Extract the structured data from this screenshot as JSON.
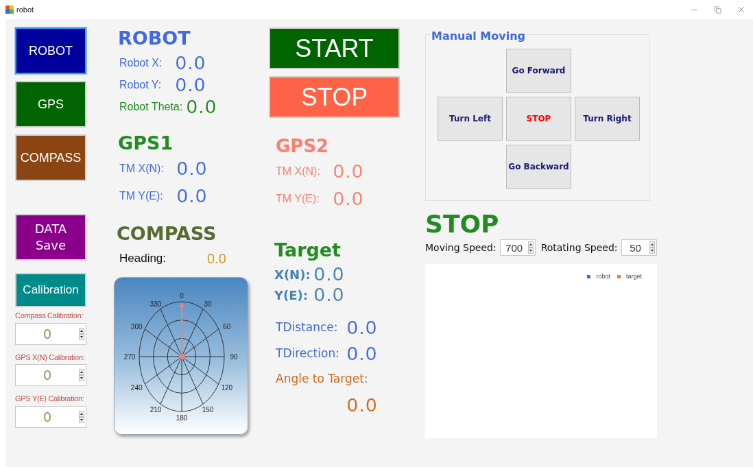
{
  "window": {
    "title": "robot"
  },
  "side_buttons": [
    {
      "label": "ROBOT",
      "color": "#00009c",
      "focused": true
    },
    {
      "label": "GPS",
      "color": "#006400",
      "focused": false
    },
    {
      "label": "COMPASS",
      "color": "#8b4513",
      "focused": false
    },
    {
      "label": "DATA Save",
      "color": "#8b008b",
      "focused": false
    },
    {
      "label": "Calibration",
      "color": "#008b8b",
      "focused": false
    }
  ],
  "calibration": [
    {
      "label": "Compass Calibration:",
      "value": "0"
    },
    {
      "label": "GPS X(N) Calibration:",
      "value": "0"
    },
    {
      "label": "GPS Y(E) Calibration:",
      "value": "0"
    }
  ],
  "robot": {
    "title": "ROBOT",
    "fields": [
      {
        "label": "Robot X:",
        "value": "0.0",
        "color": "#4169e1"
      },
      {
        "label": "Robot Y:",
        "value": "0.0",
        "color": "#4169e1"
      },
      {
        "label": "Robot Theta:",
        "value": "0.0",
        "color": "#228b22"
      }
    ]
  },
  "gps1": {
    "title": "GPS1",
    "fields": [
      {
        "label": "TM X(N):",
        "value": "0.0"
      },
      {
        "label": "TM Y(E):",
        "value": "0.0"
      }
    ]
  },
  "gps2": {
    "title": "GPS2",
    "fields": [
      {
        "label": "TM X(N):",
        "value": "0.0"
      },
      {
        "label": "TM Y(E):",
        "value": "0.0"
      }
    ]
  },
  "compass": {
    "title": "COMPASS",
    "heading_label": "Heading:",
    "heading_value": "0.0",
    "dial_labels": [
      "0",
      "30",
      "60",
      "90",
      "120",
      "150",
      "180",
      "210",
      "240",
      "270",
      "300",
      "330"
    ]
  },
  "run_buttons": [
    {
      "label": "START",
      "kind": "start"
    },
    {
      "label": "STOP",
      "kind": "stop"
    }
  ],
  "target": {
    "title": "Target",
    "fields": [
      {
        "label": "X(N):",
        "value": "0.0"
      },
      {
        "label": "Y(E):",
        "value": "0.0"
      }
    ],
    "metrics": [
      {
        "label": "TDistance:",
        "value": "0.0"
      },
      {
        "label": "TDirection:",
        "value": "0.0"
      }
    ],
    "angle": {
      "label": "Angle to Target:",
      "value": "0.0"
    }
  },
  "manual": {
    "title": "Manual Moving",
    "buttons": [
      {
        "label": "Go Forward",
        "kind": "forward"
      },
      {
        "label": "Turn Left",
        "kind": "left"
      },
      {
        "label": "STOP",
        "kind": "stop"
      },
      {
        "label": "Turn Right",
        "kind": "right"
      },
      {
        "label": "Go Backward",
        "kind": "backward"
      }
    ]
  },
  "status": "STOP",
  "speeds": [
    {
      "label": "Moving Speed:",
      "value": "700"
    },
    {
      "label": "Rotating Speed:",
      "value": "50"
    }
  ],
  "plot": {
    "legend": [
      {
        "label": "robot",
        "color": "#4472c4"
      },
      {
        "label": "target",
        "color": "#ed7d31"
      }
    ]
  }
}
